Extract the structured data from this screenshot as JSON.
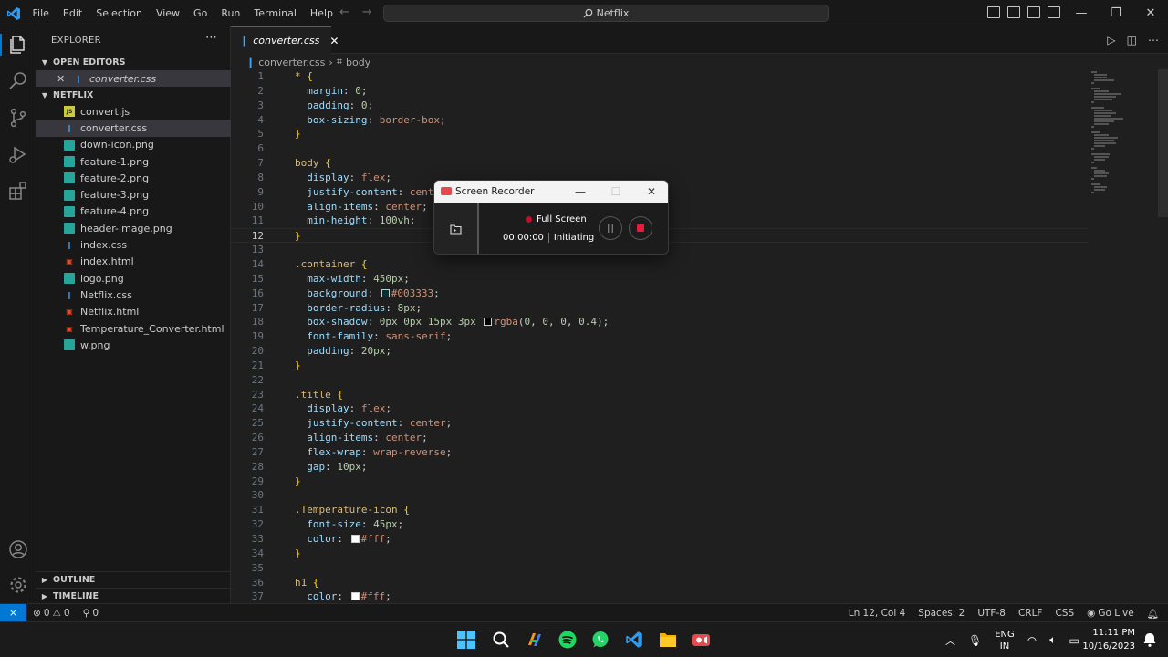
{
  "titlebar": {
    "menu": [
      "File",
      "Edit",
      "Selection",
      "View",
      "Go",
      "Run",
      "Terminal",
      "Help"
    ],
    "search_text": "Netflix",
    "brand_color": "#0078d4"
  },
  "sidebar": {
    "header": "EXPLORER",
    "open_editors_label": "OPEN EDITORS",
    "open_editor_file": "converter.css",
    "project_label": "NETFLIX",
    "files": [
      {
        "name": "convert.js",
        "type": "js"
      },
      {
        "name": "converter.css",
        "type": "css"
      },
      {
        "name": "down-icon.png",
        "type": "img"
      },
      {
        "name": "feature-1.png",
        "type": "img"
      },
      {
        "name": "feature-2.png",
        "type": "img"
      },
      {
        "name": "feature-3.png",
        "type": "img"
      },
      {
        "name": "feature-4.png",
        "type": "img"
      },
      {
        "name": "header-image.png",
        "type": "img"
      },
      {
        "name": "index.css",
        "type": "css"
      },
      {
        "name": "index.html",
        "type": "html"
      },
      {
        "name": "logo.png",
        "type": "img"
      },
      {
        "name": "Netflix.css",
        "type": "css"
      },
      {
        "name": "Netflix.html",
        "type": "html"
      },
      {
        "name": "Temperature_Converter.html",
        "type": "html"
      },
      {
        "name": "w.png",
        "type": "img"
      }
    ],
    "outline_label": "OUTLINE",
    "timeline_label": "TIMELINE"
  },
  "editor": {
    "tab_label": "converter.css",
    "breadcrumb_file": "converter.css",
    "breadcrumb_symbol": "body",
    "active_line": 12
  },
  "recorder": {
    "title": "Screen Recorder",
    "mode": "Full Screen",
    "time": "00:00:00",
    "status": "Initiating"
  },
  "statusbar": {
    "errors": "0",
    "warnings": "0",
    "ports": "0",
    "position": "Ln 12, Col 4",
    "spaces": "Spaces: 2",
    "encoding": "UTF-8",
    "eol": "CRLF",
    "language": "CSS",
    "golive": "Go Live"
  },
  "taskbar": {
    "lang_top": "ENG",
    "lang_bottom": "IN",
    "time": "11:11 PM",
    "date": "10/16/2023"
  }
}
